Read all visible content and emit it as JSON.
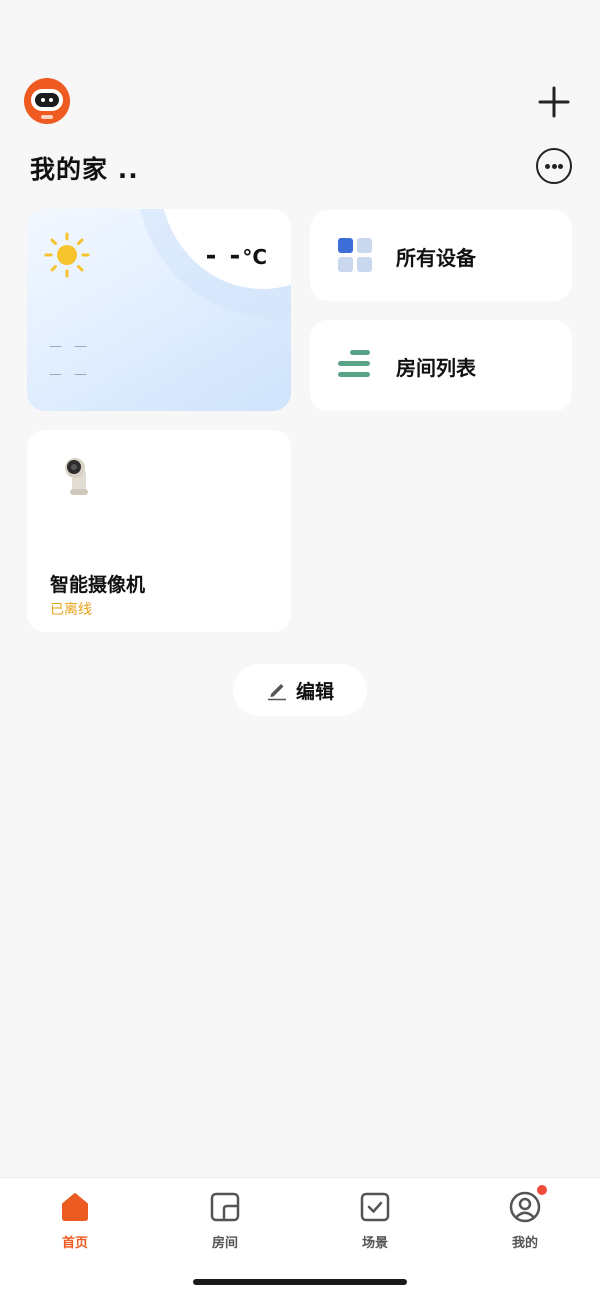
{
  "header": {
    "title": "我的家 ..",
    "icons": {
      "avatar": "robot-avatar",
      "add": "plus-icon",
      "more": "more-dots-icon"
    }
  },
  "weather": {
    "temperature": "- -",
    "unit": "°C",
    "line1": "— —",
    "line2": "— —",
    "icon": "sun-icon"
  },
  "cards": {
    "all_devices": "所有设备",
    "room_list": "房间列表"
  },
  "device": {
    "name": "智能摄像机",
    "status": "已离线",
    "icon": "camera-icon"
  },
  "edit": {
    "label": "编辑"
  },
  "nav": {
    "items": [
      {
        "label": "首页",
        "icon": "home-icon",
        "active": true
      },
      {
        "label": "房间",
        "icon": "room-icon",
        "active": false
      },
      {
        "label": "场景",
        "icon": "scene-icon",
        "active": false
      },
      {
        "label": "我的",
        "icon": "profile-icon",
        "active": false
      }
    ]
  },
  "colors": {
    "accent": "#ec5b22",
    "status_offline": "#e7a21b",
    "badge": "#f24a3d",
    "room_icon": "#5aa386",
    "grid_icon": "#3d6ed8"
  }
}
